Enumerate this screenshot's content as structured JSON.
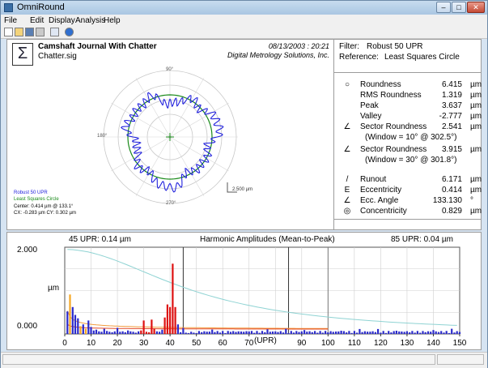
{
  "window": {
    "title": "OmniRound"
  },
  "menu": [
    "File",
    "Edit",
    "Display",
    "Analysis",
    "Help"
  ],
  "toolbar": [
    "new-icon",
    "open-icon",
    "save-icon",
    "print-icon",
    "copy-icon",
    "help-icon"
  ],
  "header": {
    "title": "Camshaft Journal With Chatter",
    "file": "Chatter.sig",
    "datetime": "08/13/2003 : 20:21",
    "company": "Digital Metrology Solutions, Inc."
  },
  "polar": {
    "angle_labels": {
      "top": "90°",
      "left": "180°",
      "bottom": "270°"
    },
    "scale_label": "2.500 µm",
    "legend": {
      "filter": "Robust 50 UPR",
      "reference": "Least Squares Circle",
      "center": "Center: 0.414 µm @ 133.1°",
      "cxcy": "CX: -0.283 µm  CY: 0.302 µm"
    },
    "colors": {
      "profile": "#2222dd",
      "reference": "#1a8a1a"
    }
  },
  "filter_panel": {
    "filter_label": "Filter:",
    "filter_value": "Robust 50 UPR",
    "reference_label": "Reference:",
    "reference_value": "Least Squares Circle"
  },
  "measurements": [
    {
      "icon": "roundness-icon",
      "glyph": "○",
      "label": "Roundness",
      "value": "6.415",
      "unit": "µm"
    },
    {
      "icon": "",
      "glyph": "",
      "label": "RMS Roundness",
      "value": "1.319",
      "unit": "µm"
    },
    {
      "icon": "",
      "glyph": "",
      "label": "Peak",
      "value": "3.637",
      "unit": "µm"
    },
    {
      "icon": "",
      "glyph": "",
      "label": "Valley",
      "value": "-2.777",
      "unit": "µm"
    },
    {
      "icon": "sector-roundness-icon",
      "glyph": "∠",
      "label": "Sector Roundness",
      "value": "2.541",
      "unit": "µm"
    },
    {
      "icon": "",
      "glyph": "",
      "label": "(Window = 10°  @ 302.5°)",
      "value": "",
      "unit": ""
    },
    {
      "icon": "sector-roundness-icon",
      "glyph": "∠",
      "label": "Sector Roundness",
      "value": "3.915",
      "unit": "µm"
    },
    {
      "icon": "",
      "glyph": "",
      "label": "(Window = 30°  @ 301.8°)",
      "value": "",
      "unit": ""
    },
    {
      "icon": "runout-icon",
      "glyph": "/",
      "label": "Runout",
      "value": "6.171",
      "unit": "µm"
    },
    {
      "icon": "eccentricity-icon",
      "glyph": "E",
      "label": "Eccentricity",
      "value": "0.414",
      "unit": "µm"
    },
    {
      "icon": "ecc-angle-icon",
      "glyph": "∠",
      "label": "Ecc. Angle",
      "value": "133.130",
      "unit": "°"
    },
    {
      "icon": "concentricity-icon",
      "glyph": "◎",
      "label": "Concentricity",
      "value": "0.829",
      "unit": "µm"
    }
  ],
  "harmonics": {
    "left_label": "45 UPR:  0.14 µm",
    "title": "Harmonic Amplitudes (Mean-to-Peak)",
    "right_label": "85 UPR:  0.04 µm",
    "ylabel": "µm",
    "xlabel": "(UPR)"
  },
  "chart_data": {
    "type": "bar",
    "ylim": [
      0,
      2.0
    ],
    "xlim": [
      0,
      150
    ],
    "y_ticks": [
      "2.000",
      "0.000"
    ],
    "x_ticks": [
      0,
      10,
      20,
      30,
      40,
      50,
      60,
      70,
      90,
      100,
      110,
      120,
      130,
      140,
      150
    ],
    "cursor_upr": [
      45,
      85
    ],
    "filter_cutoff_upr": 100,
    "bar_colors": {
      "low": "#f5a623",
      "mid": "#2b2bcc",
      "peak": "#dd1111",
      "high": "#2b2bcc"
    },
    "harmonics_upr": [
      1,
      2,
      3,
      4,
      5,
      6,
      7,
      8,
      9,
      10,
      11,
      12,
      13,
      14,
      15,
      16,
      17,
      18,
      19,
      20,
      21,
      22,
      23,
      24,
      25,
      26,
      27,
      28,
      29,
      30,
      31,
      32,
      33,
      34,
      35,
      36,
      37,
      38,
      39,
      40,
      41,
      42,
      43,
      44,
      45,
      46,
      47,
      48,
      49,
      50
    ],
    "amplitudes": [
      0.52,
      0.91,
      0.62,
      0.44,
      0.36,
      0.18,
      0.22,
      0.12,
      0.31,
      0.16,
      0.08,
      0.1,
      0.06,
      0.05,
      0.12,
      0.07,
      0.05,
      0.04,
      0.06,
      0.14,
      0.05,
      0.06,
      0.04,
      0.08,
      0.06,
      0.05,
      0.03,
      0.06,
      0.08,
      0.31,
      0.05,
      0.04,
      0.33,
      0.12,
      0.06,
      0.05,
      0.1,
      0.38,
      0.68,
      0.62,
      1.62,
      0.62,
      0.22,
      0.04,
      0.14,
      0.03,
      0.02,
      0.05,
      0.03,
      0.02
    ]
  }
}
